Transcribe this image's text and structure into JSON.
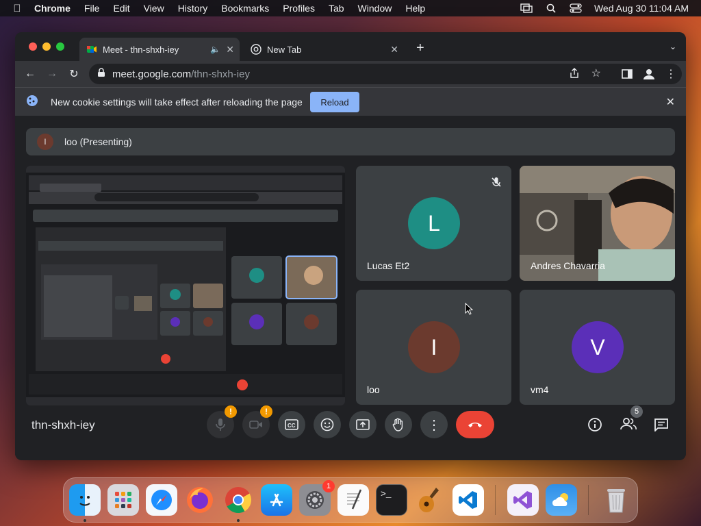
{
  "menubar": {
    "app": "Chrome",
    "items": [
      "File",
      "Edit",
      "View",
      "History",
      "Bookmarks",
      "Profiles",
      "Tab",
      "Window",
      "Help"
    ],
    "datetime": "Wed Aug 30  11:04 AM"
  },
  "tabs": [
    {
      "title": "Meet - thn-shxh-iey"
    },
    {
      "title": "New Tab"
    }
  ],
  "omnibox": {
    "host": "meet.google.com",
    "path": "/thn-shxh-iey"
  },
  "infobar": {
    "message": "New cookie settings will take effect after reloading the page",
    "button": "Reload"
  },
  "meet": {
    "presenting_label": "loo (Presenting)",
    "presenter_initial": "l",
    "meeting_code": "thn-shxh-iey",
    "participant_count": "5",
    "participants": [
      {
        "name": "Lucas Et2",
        "initial": "L",
        "color": "#1e8e84",
        "muted": true
      },
      {
        "name": "Andres Chavarria",
        "video": true
      },
      {
        "name": "loo",
        "initial": "I",
        "color": "#6b3a2e"
      },
      {
        "name": "vm4",
        "initial": "V",
        "color": "#5b2fb8"
      }
    ],
    "controls": [
      "mic",
      "camera",
      "captions",
      "emoji",
      "present",
      "raise-hand",
      "more",
      "leave"
    ],
    "warning_badge": "!"
  },
  "dock": {
    "apps": [
      "finder",
      "launchpad",
      "safari",
      "firefox",
      "chrome",
      "app-store",
      "system-settings",
      "textedit",
      "terminal",
      "garageband",
      "vscode",
      "visual-studio",
      "weather",
      "trash"
    ],
    "settings_badge": "1"
  },
  "colors": {
    "accent": "#8ab4f8",
    "leave": "#ea4335",
    "warning": "#f29900"
  }
}
